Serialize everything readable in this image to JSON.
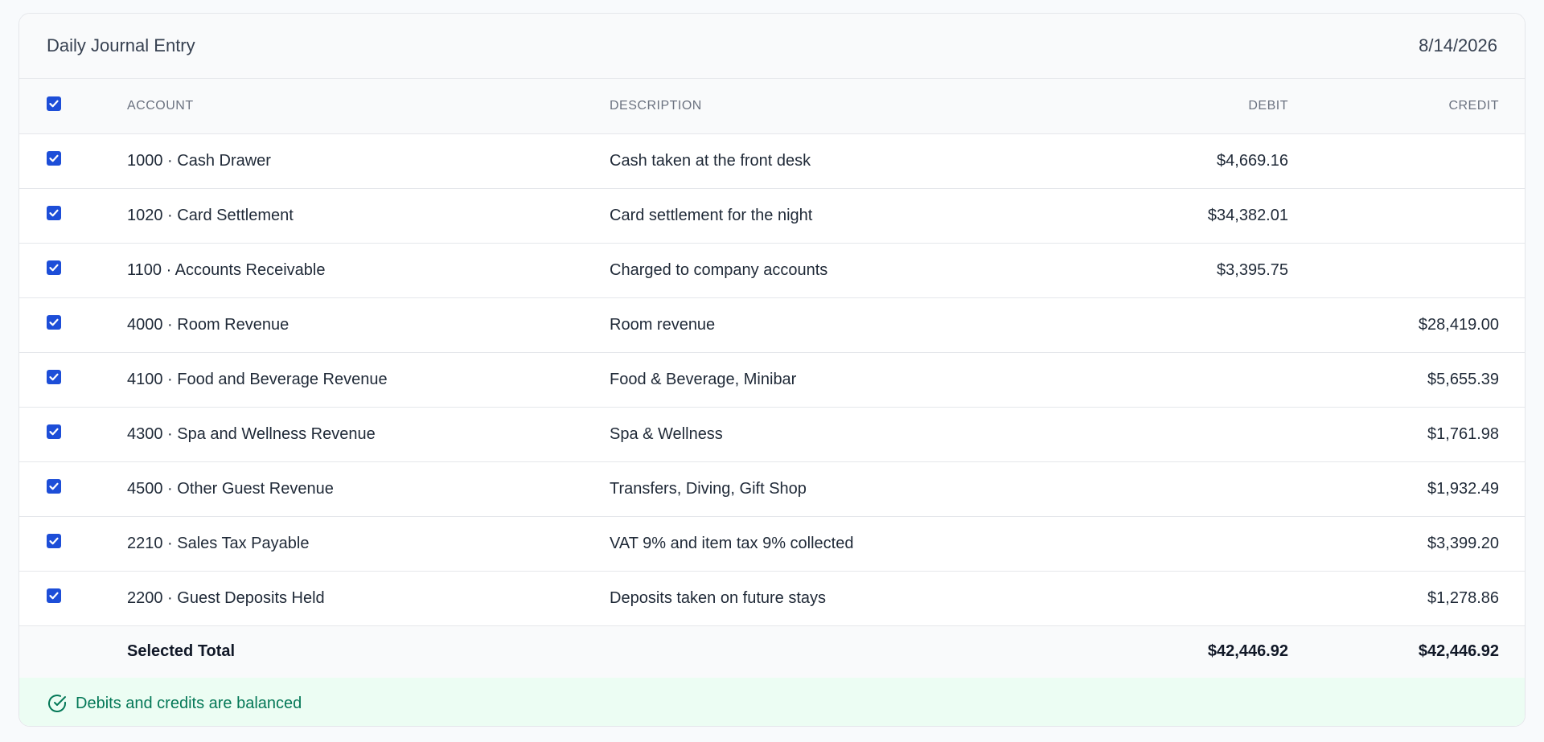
{
  "header": {
    "title": "Daily Journal Entry",
    "date": "8/14/2026"
  },
  "columns": {
    "account": "ACCOUNT",
    "description": "DESCRIPTION",
    "debit": "DEBIT",
    "credit": "CREDIT"
  },
  "rows": [
    {
      "account": "1000 · Cash Drawer",
      "description": "Cash taken at the front desk",
      "debit": "$4,669.16",
      "credit": "",
      "checked": true
    },
    {
      "account": "1020 · Card Settlement",
      "description": "Card settlement for the night",
      "debit": "$34,382.01",
      "credit": "",
      "checked": true
    },
    {
      "account": "1100 · Accounts Receivable",
      "description": "Charged to company accounts",
      "debit": "$3,395.75",
      "credit": "",
      "checked": true
    },
    {
      "account": "4000 · Room Revenue",
      "description": "Room revenue",
      "debit": "",
      "credit": "$28,419.00",
      "checked": true
    },
    {
      "account": "4100 · Food and Beverage Revenue",
      "description": "Food & Beverage, Minibar",
      "debit": "",
      "credit": "$5,655.39",
      "checked": true
    },
    {
      "account": "4300 · Spa and Wellness Revenue",
      "description": "Spa & Wellness",
      "debit": "",
      "credit": "$1,761.98",
      "checked": true
    },
    {
      "account": "4500 · Other Guest Revenue",
      "description": "Transfers, Diving, Gift Shop",
      "debit": "",
      "credit": "$1,932.49",
      "checked": true
    },
    {
      "account": "2210 · Sales Tax Payable",
      "description": "VAT 9% and item tax 9% collected",
      "debit": "",
      "credit": "$3,399.20",
      "checked": true
    },
    {
      "account": "2200 · Guest Deposits Held",
      "description": "Deposits taken on future stays",
      "debit": "",
      "credit": "$1,278.86",
      "checked": true
    }
  ],
  "totals": {
    "label": "Selected Total",
    "debit": "$42,446.92",
    "credit": "$42,446.92"
  },
  "status": {
    "text": "Debits and credits are balanced",
    "icon": "check-circle-icon",
    "color": "#047857"
  },
  "colors": {
    "accent": "#1d4ed8",
    "success_bg": "#ecfdf3"
  }
}
